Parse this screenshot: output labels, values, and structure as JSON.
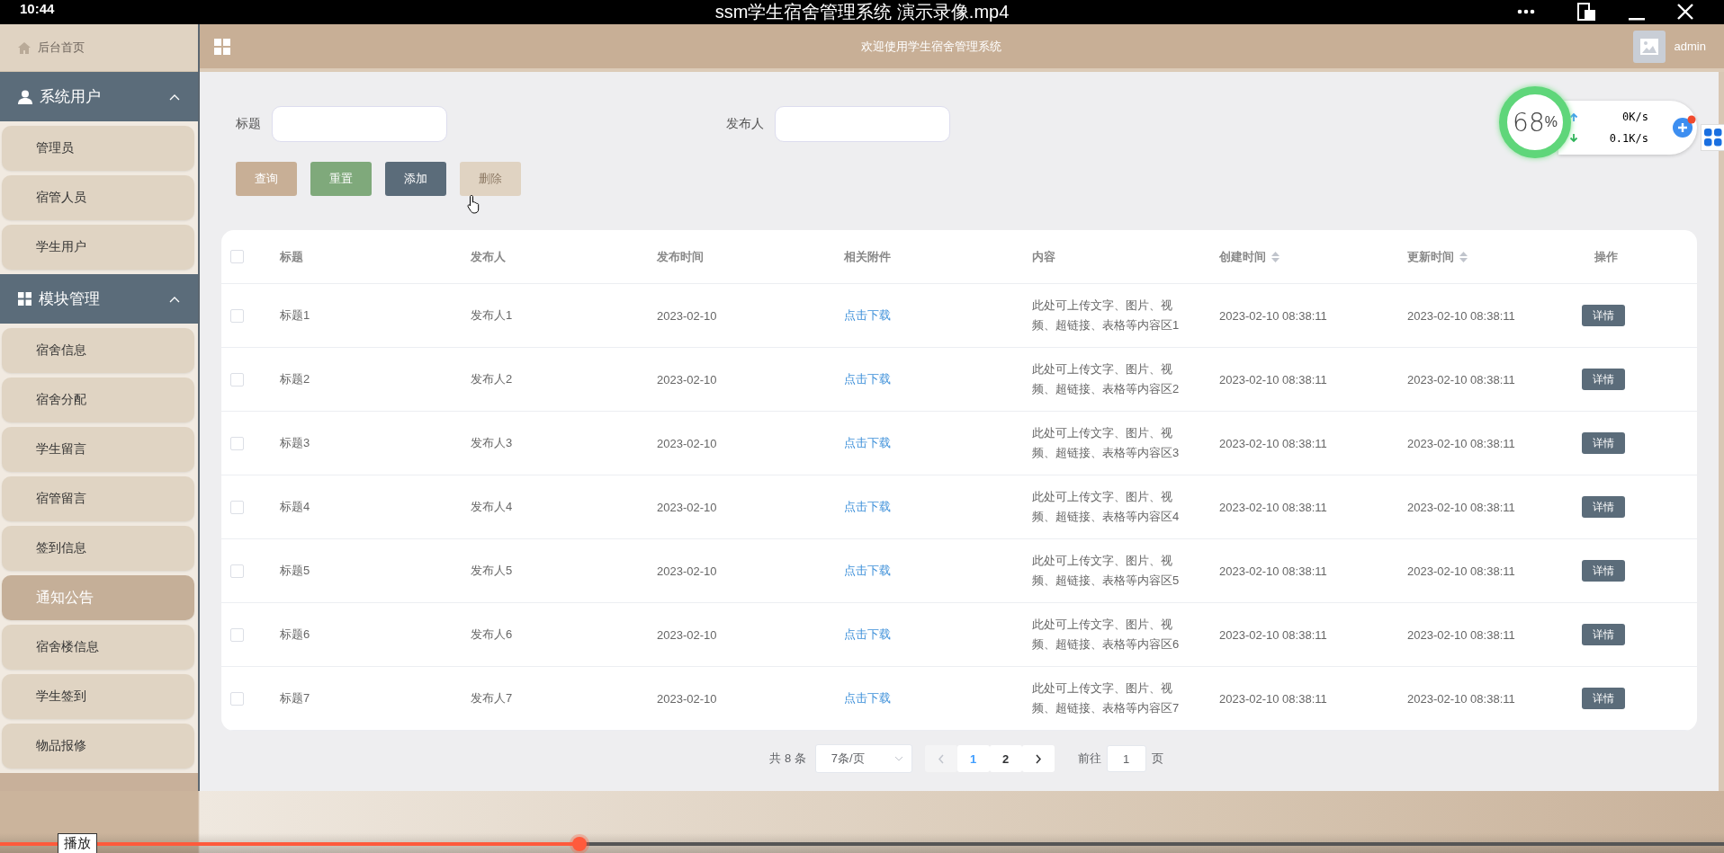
{
  "player": {
    "time": "10:44",
    "title": "ssm学生宿舍管理系统 演示录像.mp4",
    "tooltip": "播放",
    "progress": {
      "level": 0.336
    }
  },
  "header": {
    "title": "欢迎使用学生宿舍管理系统",
    "user": "admin"
  },
  "sidebar": {
    "home": "后台首页",
    "groups": [
      {
        "label": "系统用户",
        "kind": "user",
        "expanded": true,
        "items": [
          {
            "label": "管理员",
            "selected": false
          },
          {
            "label": "宿管人员",
            "selected": false
          },
          {
            "label": "学生用户",
            "selected": false
          }
        ]
      },
      {
        "label": "模块管理",
        "kind": "grid",
        "expanded": true,
        "items": [
          {
            "label": "宿舍信息",
            "selected": false
          },
          {
            "label": "宿舍分配",
            "selected": false
          },
          {
            "label": "学生留言",
            "selected": false
          },
          {
            "label": "宿管留言",
            "selected": false
          },
          {
            "label": "签到信息",
            "selected": false
          },
          {
            "label": "通知公告",
            "selected": true
          },
          {
            "label": "宿舍楼信息",
            "selected": false
          },
          {
            "label": "学生签到",
            "selected": false
          },
          {
            "label": "物品报修",
            "selected": false
          }
        ]
      }
    ]
  },
  "search": {
    "fields": [
      {
        "label": "标题"
      },
      {
        "label": "发布人"
      }
    ],
    "buttons": [
      {
        "label": "查询",
        "kind": "search",
        "disabled": false
      },
      {
        "label": "重置",
        "kind": "reset",
        "disabled": false
      },
      {
        "label": "添加",
        "kind": "add",
        "disabled": false
      },
      {
        "label": "删除",
        "kind": "delete",
        "disabled": true
      }
    ]
  },
  "table": {
    "all_checked": false,
    "columns": [
      {
        "label": "标题",
        "sortable": false
      },
      {
        "label": "发布人",
        "sortable": false
      },
      {
        "label": "发布时间",
        "sortable": false
      },
      {
        "label": "相关附件",
        "sortable": false
      },
      {
        "label": "内容",
        "sortable": false
      },
      {
        "label": "创建时间",
        "sortable": true
      },
      {
        "label": "更新时间",
        "sortable": true
      },
      {
        "label": "操作",
        "sortable": false
      }
    ],
    "rows": [
      {
        "checked": false,
        "cells": [
          "标题1",
          "发布人1",
          "2023-02-10",
          "点击下载",
          "此处可上传文字、图片、视频、超链接、表格等内容区1",
          "2023-02-10 08:38:11",
          "2023-02-10 08:38:11"
        ],
        "action": "详情"
      },
      {
        "checked": false,
        "cells": [
          "标题2",
          "发布人2",
          "2023-02-10",
          "点击下载",
          "此处可上传文字、图片、视频、超链接、表格等内容区2",
          "2023-02-10 08:38:11",
          "2023-02-10 08:38:11"
        ],
        "action": "详情"
      },
      {
        "checked": false,
        "cells": [
          "标题3",
          "发布人3",
          "2023-02-10",
          "点击下载",
          "此处可上传文字、图片、视频、超链接、表格等内容区3",
          "2023-02-10 08:38:11",
          "2023-02-10 08:38:11"
        ],
        "action": "详情"
      },
      {
        "checked": false,
        "cells": [
          "标题4",
          "发布人4",
          "2023-02-10",
          "点击下载",
          "此处可上传文字、图片、视频、超链接、表格等内容区4",
          "2023-02-10 08:38:11",
          "2023-02-10 08:38:11"
        ],
        "action": "详情"
      },
      {
        "checked": false,
        "cells": [
          "标题5",
          "发布人5",
          "2023-02-10",
          "点击下载",
          "此处可上传文字、图片、视频、超链接、表格等内容区5",
          "2023-02-10 08:38:11",
          "2023-02-10 08:38:11"
        ],
        "action": "详情"
      },
      {
        "checked": false,
        "cells": [
          "标题6",
          "发布人6",
          "2023-02-10",
          "点击下载",
          "此处可上传文字、图片、视频、超链接、表格等内容区6",
          "2023-02-10 08:38:11",
          "2023-02-10 08:38:11"
        ],
        "action": "详情"
      },
      {
        "checked": false,
        "cells": [
          "标题7",
          "发布人7",
          "2023-02-10",
          "点击下载",
          "此处可上传文字、图片、视频、超链接、表格等内容区7",
          "2023-02-10 08:38:11",
          "2023-02-10 08:38:11"
        ],
        "action": "详情"
      }
    ]
  },
  "pagination": {
    "total": "共 8 条",
    "page_size": "7条/页",
    "prev_disabled": true,
    "pages": [
      {
        "label": "1",
        "selected": true
      },
      {
        "label": "2",
        "selected": false
      }
    ],
    "goto_label": "前往",
    "goto_value": "1",
    "goto_suffix": "页"
  },
  "net_widget": {
    "percent": "68",
    "unit": "%",
    "upload": "0K/s",
    "download": "0.1K/s"
  }
}
